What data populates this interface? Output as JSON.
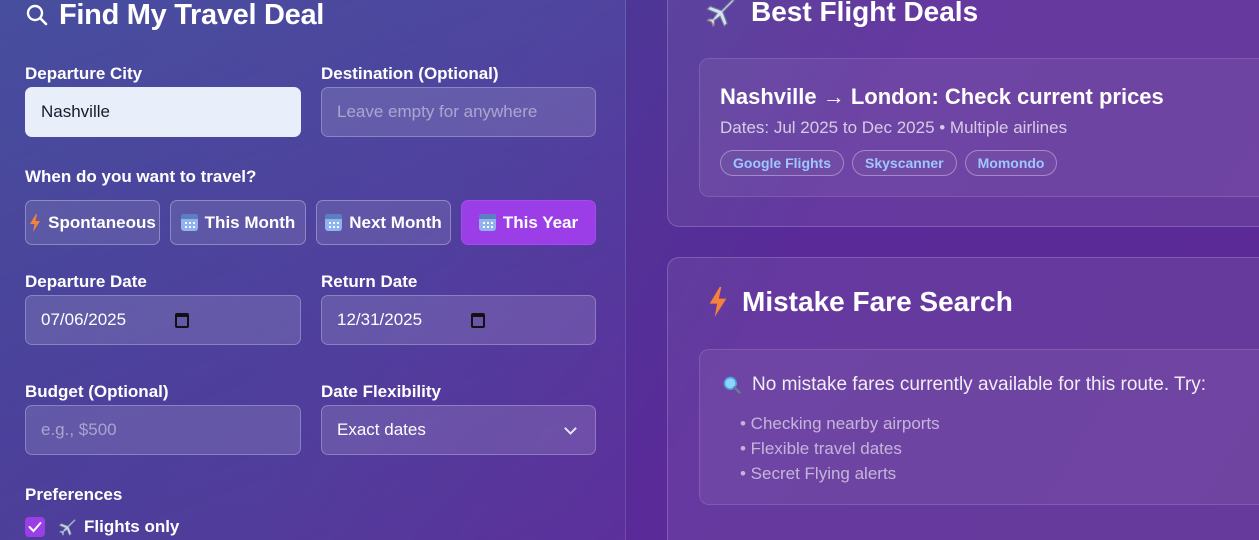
{
  "search": {
    "title": "Find My Travel Deal",
    "departure_label": "Departure City",
    "departure_value": "Nashville",
    "destination_label": "Destination (Optional)",
    "destination_placeholder": "Leave empty for anywhere",
    "when_label": "When do you want to travel?",
    "timing_options": [
      {
        "label": "Spontaneous",
        "icon": "lightning-icon",
        "active": false
      },
      {
        "label": "This Month",
        "icon": "calendar-icon",
        "active": false
      },
      {
        "label": "Next Month",
        "icon": "calendar-icon",
        "active": false
      },
      {
        "label": "This Year",
        "icon": "calendar-icon",
        "active": true
      }
    ],
    "departure_date_label": "Departure Date",
    "departure_date_value": "07/06/2025",
    "return_date_label": "Return Date",
    "return_date_value": "12/31/2025",
    "budget_label": "Budget (Optional)",
    "budget_placeholder": "e.g., $500",
    "flexibility_label": "Date Flexibility",
    "flexibility_value": "Exact dates",
    "preferences_label": "Preferences",
    "preferences": [
      {
        "label": "Flights only",
        "checked": true,
        "icon": "airplane-icon"
      }
    ]
  },
  "best_deals": {
    "title": "Best Flight Deals",
    "deal": {
      "route": "Nashville → London: Check current prices",
      "details": "Dates: Jul 2025 to Dec 2025 • Multiple airlines",
      "sites": [
        "Google Flights",
        "Skyscanner",
        "Momondo"
      ]
    }
  },
  "mistake_fares": {
    "title": "Mistake Fare Search",
    "message": "No mistake fares currently available for this route. Try:",
    "suggestions": [
      "• Checking nearby airports",
      "• Flexible travel dates",
      "• Secret Flying alerts"
    ]
  },
  "colors": {
    "accent": "#9b3ee8",
    "tag_text": "#9ec6ff",
    "lightning": "#f5813a"
  }
}
